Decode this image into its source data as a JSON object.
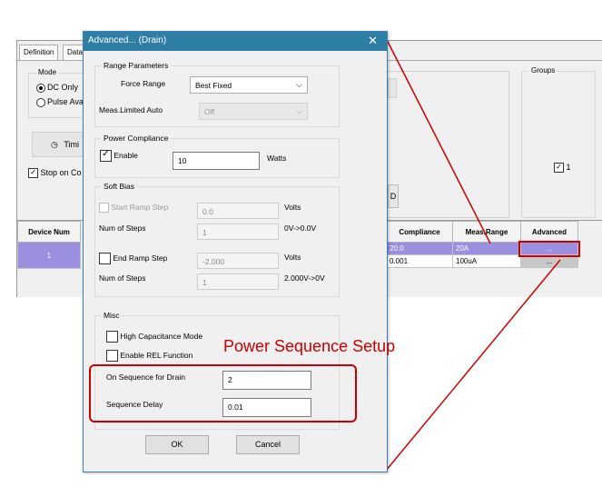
{
  "background_window": {
    "tabs": [
      "Definition",
      "Data"
    ],
    "mode_label": "Mode",
    "mode_options": [
      "DC Only",
      "Pulse Ava"
    ],
    "timing_button": "Timi",
    "stop_label": "Stop on Co",
    "groups_label": "Groups",
    "groups_check": "1",
    "d_button": "D",
    "table": {
      "headers": [
        "Device Num",
        "Compliance",
        "Meas.Range",
        "Advanced"
      ],
      "rows": [
        {
          "device": "1",
          "compliance": "20.0",
          "meas_range": "20A",
          "advanced": "..."
        },
        {
          "device": "",
          "compliance": "0.001",
          "meas_range": "100uA",
          "advanced": "..."
        }
      ]
    }
  },
  "dialog": {
    "title": "Advanced... (Drain)",
    "close": "✕",
    "range": {
      "group_label": "Range Parameters",
      "force_range_label": "Force Range",
      "force_range_value": "Best Fixed",
      "meas_auto_label": "Meas.Limited Auto",
      "meas_auto_value": "Off"
    },
    "compliance": {
      "group_label": "Power Compliance",
      "enable_label": "Enable",
      "value": "10",
      "unit": "Watts"
    },
    "soft_bias": {
      "group_label": "Soft Bias",
      "start_label": "Start Ramp Step",
      "start_value": "0.0",
      "start_unit": "Volts",
      "steps_label": "Num of Steps",
      "steps_value": "1",
      "steps_note": "0V->0.0V",
      "end_label": "End Ramp Step",
      "end_value": "-2.000",
      "end_unit": "Volts",
      "steps2_label": "Num of Steps",
      "steps2_value": "1",
      "steps2_note": "2.000V->0V"
    },
    "misc": {
      "group_label": "Misc",
      "high_cap_label": "High Capacitance Mode",
      "rel_label": "Enable REL Function",
      "on_seq_label": "On Sequence for Drain",
      "on_seq_value": "2",
      "delay_label": "Sequence Delay",
      "delay_value": "0.01"
    },
    "ok_label": "OK",
    "cancel_label": "Cancel"
  },
  "annotation": {
    "text": "Power Sequence Setup",
    "color": "#cc0000"
  },
  "colors": {
    "title_bar": "#2f7ea6",
    "selected_row": "#9b8fe0",
    "highlight": "#cc0000"
  }
}
